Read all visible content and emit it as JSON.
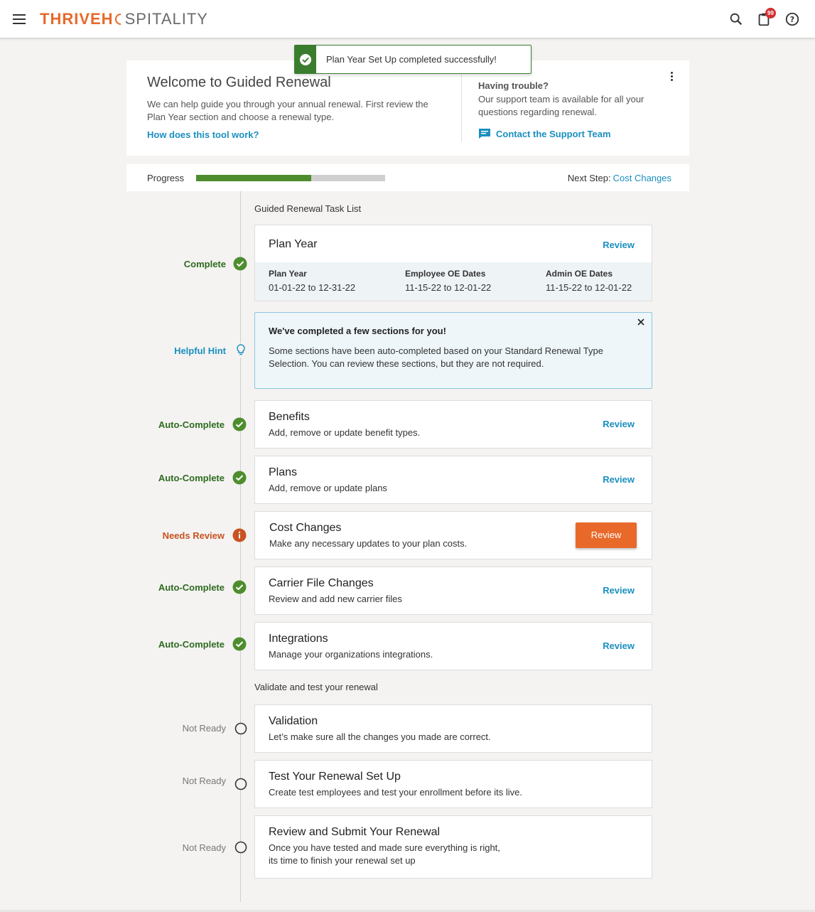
{
  "header": {
    "logo_part1": "THRIVEH",
    "logo_part2": "SPITALITY",
    "notification_count": "99"
  },
  "toast": {
    "message": "Plan Year Set Up completed successfully!"
  },
  "welcome": {
    "title": "Welcome to Guided Renewal",
    "intro": "We can help guide you through your annual renewal. First review the Plan Year section and choose a renewal type.",
    "how_link": "How does this tool work?",
    "trouble_title": "Having trouble?",
    "trouble_text": "Our support team is available for all your questions regarding renewal.",
    "support_link": "Contact the Support Team"
  },
  "progress": {
    "label": "Progress",
    "fraction": 0.61,
    "next_step_label": "Next Step:",
    "next_step_value": "Cost Changes"
  },
  "task_list": {
    "title": "Guided Renewal Task List",
    "plan_year": {
      "status": "Complete",
      "title": "Plan Year",
      "review": "Review",
      "cols": [
        {
          "header": "Plan Year",
          "value": "01-01-22 to 12-31-22"
        },
        {
          "header": "Employee OE Dates",
          "value": "11-15-22 to 12-01-22"
        },
        {
          "header": "Admin OE Dates",
          "value": "11-15-22 to 12-01-22"
        }
      ]
    },
    "hint": {
      "status": "Helpful Hint",
      "title": "We've completed a few sections for you!",
      "text": "Some sections have been auto-completed based on your Standard Renewal Type Selection. You can review these sections, but they are not required."
    },
    "items": [
      {
        "status": "Auto-Complete",
        "title": "Benefits",
        "desc": "Add, remove or update benefit types.",
        "review": "Review"
      },
      {
        "status": "Auto-Complete",
        "title": "Plans",
        "desc": "Add, remove or update plans",
        "review": "Review"
      },
      {
        "status": "Needs Review",
        "title": "Cost Changes",
        "desc": "Make any necessary updates to your plan costs.",
        "review": "Review"
      },
      {
        "status": "Auto-Complete",
        "title": "Carrier File Changes",
        "desc": "Review and add new carrier files",
        "review": "Review"
      },
      {
        "status": "Auto-Complete",
        "title": "Integrations",
        "desc": "Manage your organizations integrations.",
        "review": "Review"
      }
    ]
  },
  "validate": {
    "title": "Validate and test your renewal",
    "items": [
      {
        "status": "Not Ready",
        "title": "Validation",
        "desc": "Let’s make sure all the changes you made are correct."
      },
      {
        "status": "Not Ready",
        "title": "Test Your Renewal Set Up",
        "desc": "Create test employees and test your enrollment before its live."
      },
      {
        "status": "Not Ready",
        "title": "Review and Submit Your Renewal",
        "desc_line1": "Once you have tested and made sure everything is right,",
        "desc_line2": "its time to finish your renewal set up"
      }
    ]
  },
  "colors": {
    "brand_orange": "#e8692a",
    "link_blue": "#1a8fbf",
    "success_green": "#3a7d2e",
    "progress_green": "#4e8d2e"
  }
}
